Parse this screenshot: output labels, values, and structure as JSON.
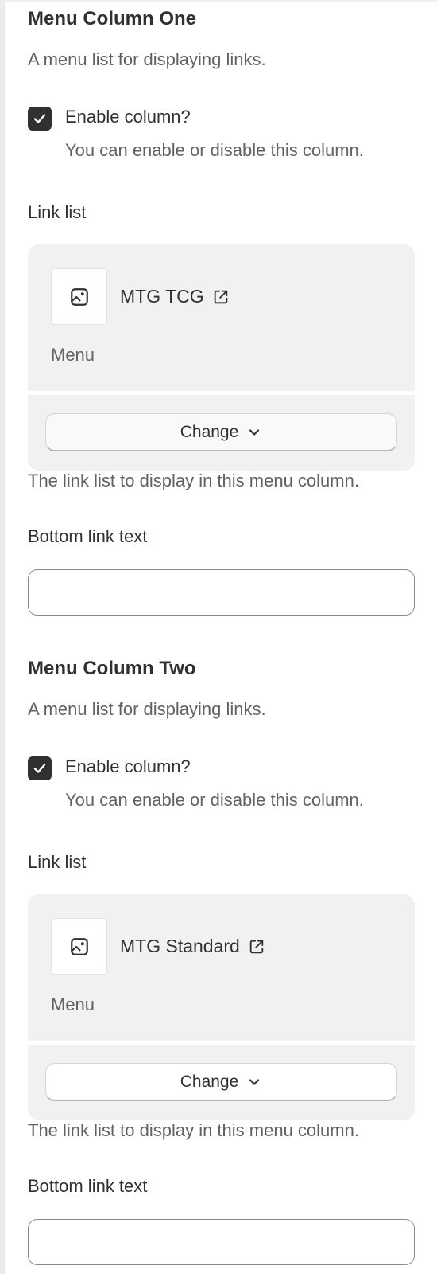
{
  "sections": [
    {
      "title": "Menu Column One",
      "description": "A menu list for displaying links.",
      "enable": {
        "label": "Enable column?",
        "help": "You can enable or disable this column.",
        "checked": true
      },
      "link_list": {
        "label": "Link list",
        "item_name": "MTG TCG",
        "item_type": "Menu",
        "change_label": "Change",
        "help": "The link list to display in this menu column."
      },
      "bottom_link": {
        "label": "Bottom link text",
        "value": ""
      }
    },
    {
      "title": "Menu Column Two",
      "description": "A menu list for displaying links.",
      "enable": {
        "label": "Enable column?",
        "help": "You can enable or disable this column.",
        "checked": true
      },
      "link_list": {
        "label": "Link list",
        "item_name": "MTG Standard",
        "item_type": "Menu",
        "change_label": "Change",
        "help": "The link list to display in this menu column."
      },
      "bottom_link": {
        "label": "Bottom link text",
        "value": ""
      }
    }
  ],
  "icons": {
    "thumbnail": "image-icon",
    "external": "external-link-icon",
    "checkmark": "checkmark-icon",
    "dropdown": "chevron-down-icon"
  },
  "colors": {
    "text": "#303030",
    "muted": "#616161",
    "card_bg": "#f1f1f1",
    "checkbox": "#303030"
  }
}
